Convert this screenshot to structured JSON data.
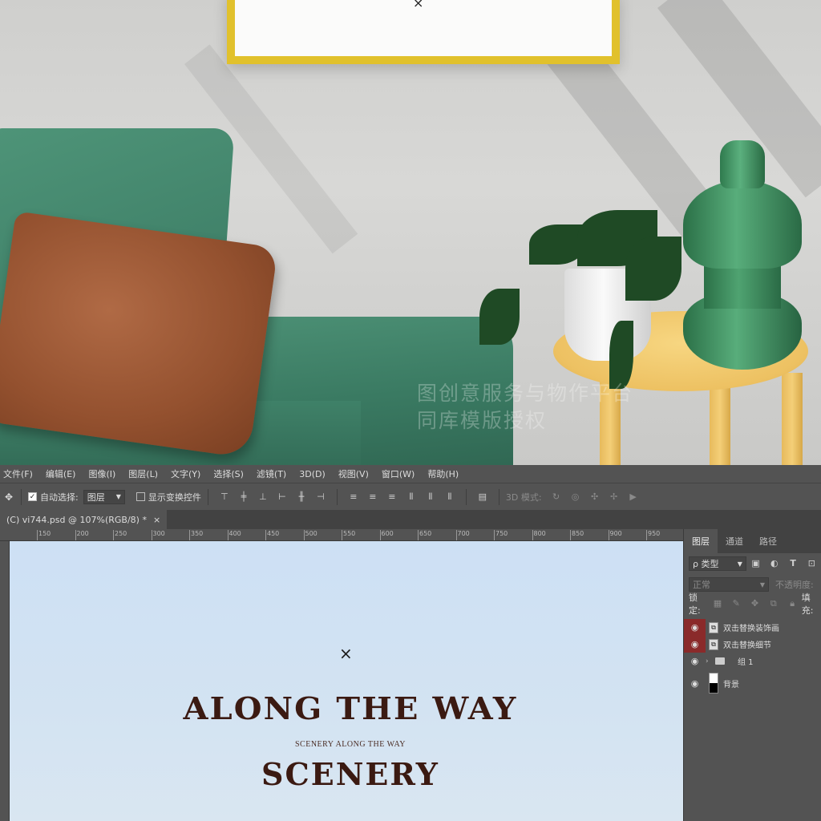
{
  "watermark": {
    "line1": "图创意服务与物作平台",
    "line2": "同库模版授权"
  },
  "mockup": {
    "frame_mark": "×"
  },
  "menubar": {
    "items": [
      "文件(F)",
      "编辑(E)",
      "图像(I)",
      "图层(L)",
      "文字(Y)",
      "选择(S)",
      "滤镜(T)",
      "3D(D)",
      "视图(V)",
      "窗口(W)",
      "帮助(H)"
    ]
  },
  "options": {
    "auto_select_label": "自动选择:",
    "auto_select_value": "图层",
    "show_transform_label": "显示变换控件",
    "mode_3d_label": "3D 模式:"
  },
  "document": {
    "tab_title": "(C) vi744.psd @ 107%(RGB/8) *",
    "close": "×"
  },
  "ruler": {
    "ticks": [
      "150",
      "200",
      "250",
      "300",
      "350",
      "400",
      "450",
      "500",
      "550",
      "600",
      "650",
      "700",
      "750",
      "800",
      "850",
      "900",
      "950"
    ]
  },
  "canvas": {
    "mark": "×",
    "title_line1": "ALONG THE WAY",
    "subtitle": "SCENERY ALONG THE WAY",
    "title_line2": "SCENERY"
  },
  "layers_panel": {
    "tabs": [
      "图层",
      "通道",
      "路径"
    ],
    "filter_label": "ρ 类型",
    "blend_mode": "正常",
    "opacity_label": "不透明度:",
    "lock_label": "锁定:",
    "fill_label": "填充:",
    "layers": [
      {
        "name": "双击替换装饰画",
        "selected_eye": true
      },
      {
        "name": "双击替换细节",
        "selected_eye": true
      },
      {
        "name": "组 1",
        "selected_eye": false
      },
      {
        "name": "背景",
        "selected_eye": false
      }
    ]
  },
  "colors": {
    "ps_panel": "#535353",
    "canvas_bg": "#cfe1f3",
    "title_color": "#3b1a12",
    "frame_gold": "#e1c12c"
  }
}
